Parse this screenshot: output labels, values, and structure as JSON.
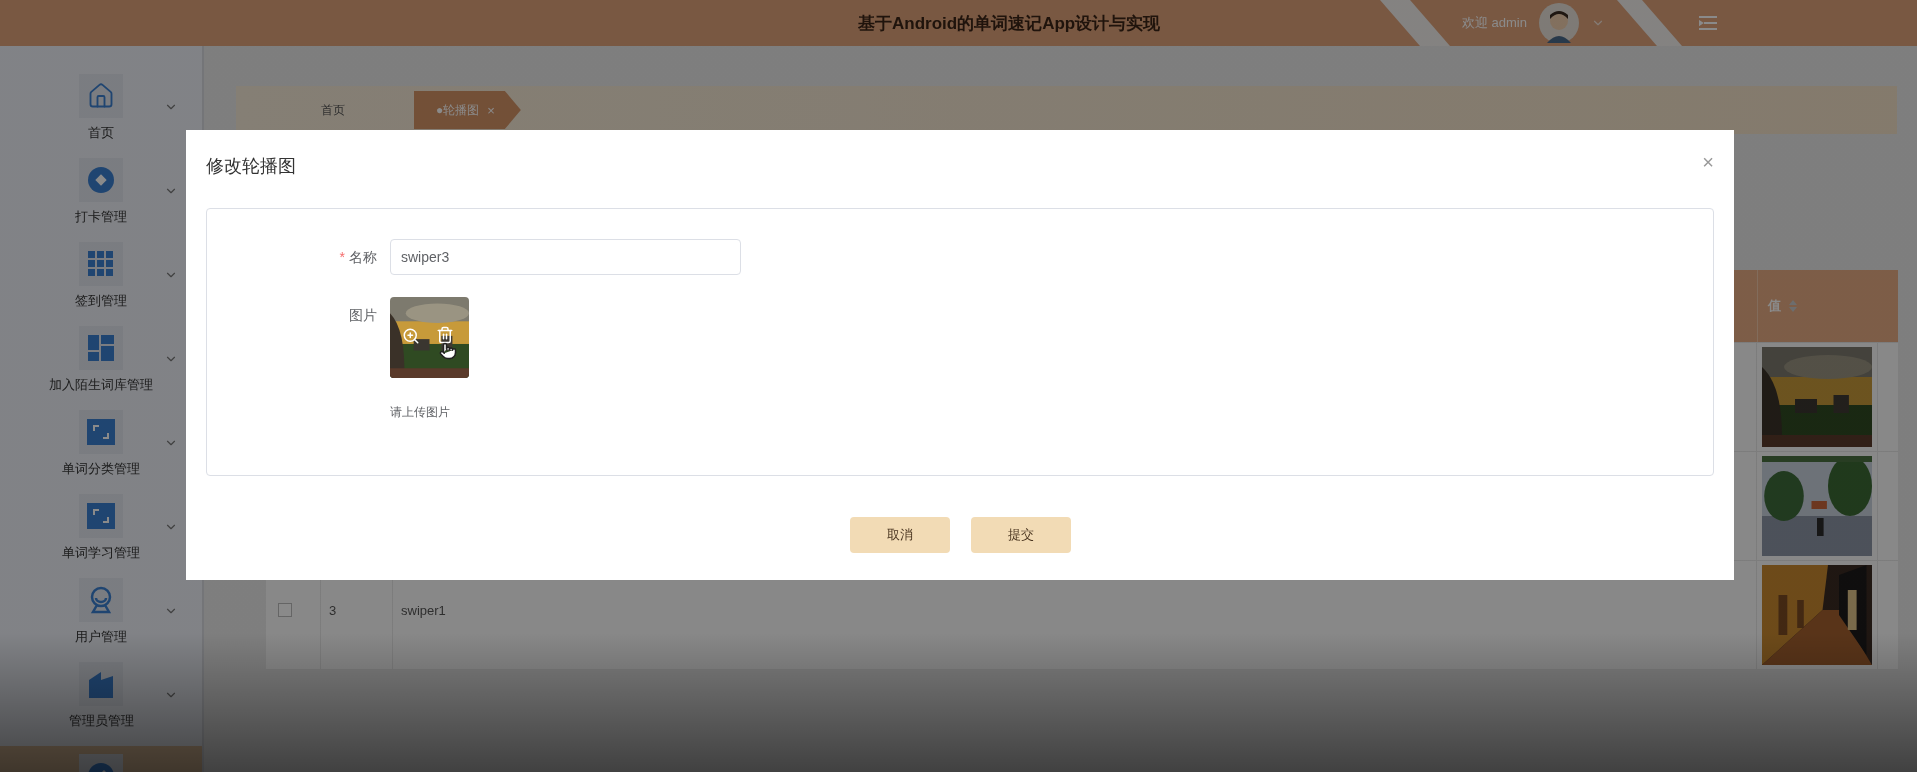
{
  "header": {
    "title": "基于Android的单词速记App设计与实现",
    "welcome": "欢迎 admin"
  },
  "sidebar": {
    "items": [
      {
        "label": "首页",
        "kind": "home",
        "selected": false
      },
      {
        "label": "打卡管理",
        "kind": "diamond",
        "selected": false
      },
      {
        "label": "签到管理",
        "kind": "grid",
        "selected": false
      },
      {
        "label": "加入陌生词库管理",
        "kind": "tiles",
        "selected": false
      },
      {
        "label": "单词分类管理",
        "kind": "expand",
        "selected": false
      },
      {
        "label": "单词学习管理",
        "kind": "expand",
        "selected": false
      },
      {
        "label": "用户管理",
        "kind": "user",
        "selected": false
      },
      {
        "label": "管理员管理",
        "kind": "building",
        "selected": false
      },
      {
        "kind": "edit",
        "selected": true
      }
    ]
  },
  "breadcrumb": {
    "tabs": [
      {
        "label": "首页",
        "selected": false
      },
      {
        "label": "●轮播图",
        "close": "×",
        "selected": true
      }
    ]
  },
  "table": {
    "columns": [
      {
        "label": "值"
      }
    ],
    "rows": [
      {
        "image": {
          "kind": "picture"
        }
      },
      {
        "image": {
          "kind": "picture"
        }
      },
      {
        "checked": false,
        "index": "3",
        "name": "swiper1",
        "image": {
          "kind": "picture"
        }
      }
    ]
  },
  "dialog": {
    "title": "修改轮播图",
    "close": "×",
    "fields": [
      {
        "kind": "text",
        "label": "名称",
        "required_mark": "*",
        "value": "swiper3"
      },
      {
        "label": "图片",
        "hint": "请上传图片"
      }
    ],
    "buttons": [
      {
        "label": "取消"
      },
      {
        "label": "提交"
      }
    ]
  }
}
